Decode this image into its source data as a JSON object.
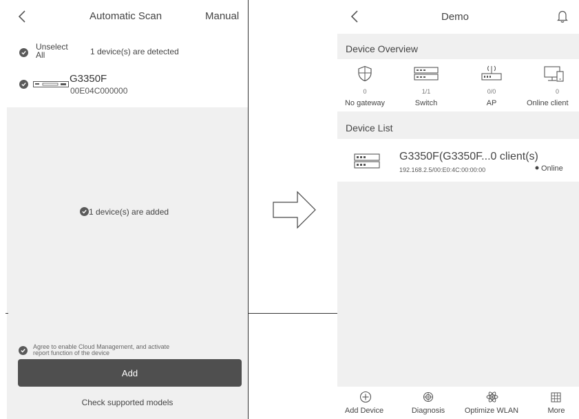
{
  "left": {
    "header": {
      "back_glyph": "<",
      "title": "Automatic Scan",
      "manual": "Manual"
    },
    "unselect_all": "Unselect All",
    "detected": "1 device(s) are detected",
    "device": {
      "name": "G3350F",
      "id": "00E04C000000"
    },
    "added_message": "1 device(s) are added",
    "agree_text_line1": "Agree to enable Cloud Management, and activate",
    "agree_text_line2": "report function of the device",
    "add_button": "Add",
    "check_models": "Check supported models"
  },
  "right": {
    "header": {
      "back_glyph": "<",
      "title": "Demo"
    },
    "overview_title": "Device Overview",
    "stats": [
      {
        "value": "0",
        "label": "No gateway",
        "icon": "shield-icon"
      },
      {
        "value": "1/1",
        "label": "Switch",
        "icon": "switch-icon"
      },
      {
        "value": "0/0",
        "label": "AP",
        "icon": "access-point-icon"
      },
      {
        "value": "0",
        "label": "Online client",
        "icon": "monitor-icon"
      }
    ],
    "device_list_title": "Device List",
    "device": {
      "name": "G3350F(G3350F...0 client(s)",
      "address": "192.168.2.5/00:E0:4C:00:00:00",
      "status": "Online"
    },
    "tabs": [
      {
        "label": "Add Device",
        "icon": "add-device-icon"
      },
      {
        "label": "Diagnosis",
        "icon": "diagnosis-icon"
      },
      {
        "label": "Optimize WLAN",
        "icon": "optimize-wlan-icon"
      },
      {
        "label": "More",
        "icon": "grid-icon"
      }
    ]
  },
  "colors": {
    "background": "#f0f0f0",
    "surface": "#ffffff",
    "button": "#4f4f4f",
    "check": "#5a5a5a"
  }
}
